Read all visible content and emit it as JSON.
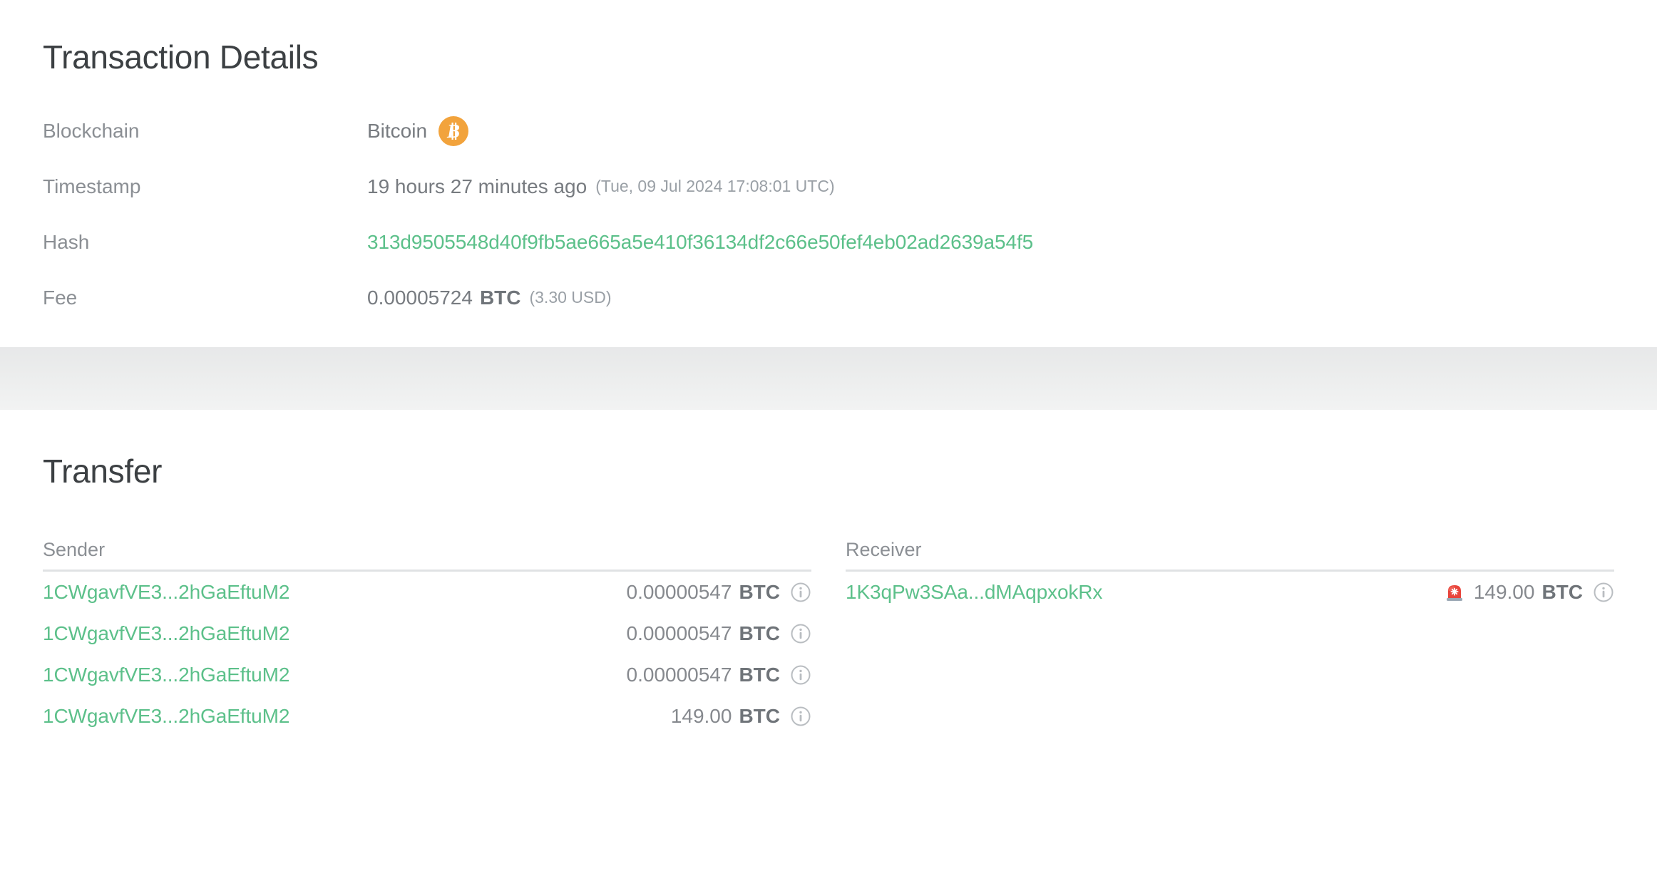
{
  "details": {
    "title": "Transaction Details",
    "rows": [
      {
        "label": "Blockchain",
        "value": "Bitcoin",
        "icon": "bitcoin-icon"
      },
      {
        "label": "Timestamp",
        "value": "19 hours 27 minutes ago",
        "secondary": "(Tue, 09 Jul 2024 17:08:01 UTC)"
      },
      {
        "label": "Hash",
        "value": "313d9505548d40f9fb5ae665a5e410f36134df2c66e50fef4eb02ad2639a54f5"
      },
      {
        "label": "Fee",
        "value": "0.00005724",
        "unit": "BTC",
        "secondary": "(3.30 USD)"
      }
    ]
  },
  "transfer": {
    "title": "Transfer",
    "sender": {
      "header": "Sender",
      "rows": [
        {
          "address": "1CWgavfVE3...2hGaEftuM2",
          "amount": "0.00000547",
          "unit": "BTC",
          "info_icon": "info-circle-icon"
        },
        {
          "address": "1CWgavfVE3...2hGaEftuM2",
          "amount": "0.00000547",
          "unit": "BTC",
          "info_icon": "info-circle-icon"
        },
        {
          "address": "1CWgavfVE3...2hGaEftuM2",
          "amount": "0.00000547",
          "unit": "BTC",
          "info_icon": "info-circle-icon"
        },
        {
          "address": "1CWgavfVE3...2hGaEftuM2",
          "amount": "149.00",
          "unit": "BTC",
          "info_icon": "info-circle-icon"
        }
      ]
    },
    "receiver": {
      "header": "Receiver",
      "rows": [
        {
          "address": "1K3qPw3SAa...dMAqpxokRx",
          "badge": "police-car-light-emoji",
          "amount": "149.00",
          "unit": "BTC",
          "info_icon": "info-circle-icon"
        }
      ]
    }
  },
  "colors": {
    "link_green": "#5cc08a",
    "bitcoin_orange": "#f2a33c",
    "label_gray": "#8b8f94",
    "value_gray": "#777b80",
    "title_dark": "#3c4043",
    "alert_red": "#e8453c"
  }
}
